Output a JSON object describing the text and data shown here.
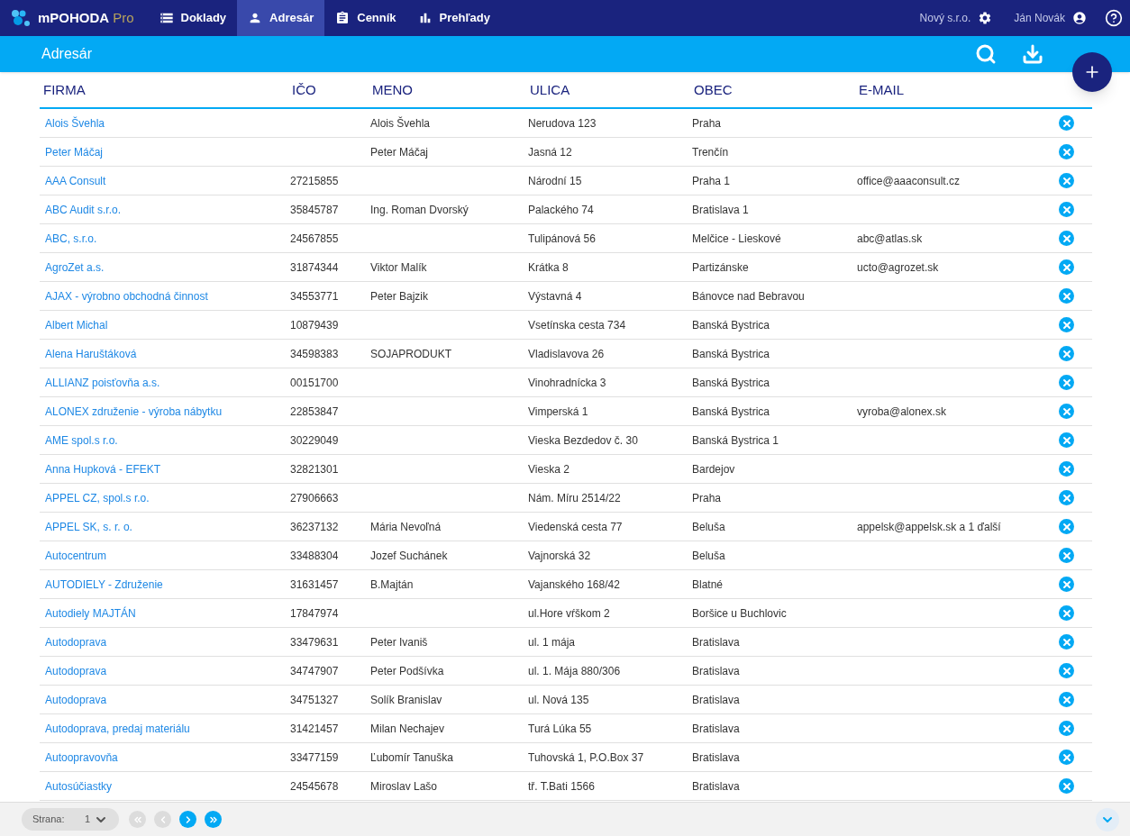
{
  "app": {
    "name": "mPOHODA",
    "edition": "Pro"
  },
  "nav": [
    {
      "label": "Doklady",
      "kind": "documents",
      "selected": false
    },
    {
      "label": "Adresár",
      "kind": "contacts",
      "selected": true
    },
    {
      "label": "Cenník",
      "kind": "pricelist",
      "selected": false
    },
    {
      "label": "Prehľady",
      "kind": "reports",
      "selected": false
    }
  ],
  "company": "Nový s.r.o.",
  "user": "Ján Novák",
  "page_title": "Adresár",
  "table": {
    "columns": [
      "FIRMA",
      "IČO",
      "MENO",
      "ULICA",
      "OBEC",
      "E-MAIL"
    ],
    "rows": [
      [
        "Alois Švehla",
        "",
        "Alois Švehla",
        "Nerudova 123",
        "Praha",
        ""
      ],
      [
        "Peter Máčaj",
        "",
        "Peter Máčaj",
        "Jasná 12",
        "Trenčín",
        ""
      ],
      [
        "AAA Consult",
        "27215855",
        "",
        "Národní 15",
        "Praha 1",
        "office@aaaconsult.cz"
      ],
      [
        "ABC Audit s.r.o.",
        "35845787",
        "Ing. Roman Dvorský",
        "Palackého 74",
        "Bratislava 1",
        ""
      ],
      [
        "ABC, s.r.o.",
        "24567855",
        "",
        "Tulipánová 56",
        "Melčice - Lieskové",
        "abc@atlas.sk"
      ],
      [
        "AgroZet a.s.",
        "31874344",
        "Viktor Malík",
        "Krátka 8",
        "Partizánske",
        "ucto@agrozet.sk"
      ],
      [
        "AJAX - výrobno obchodná činnost",
        "34553771",
        "Peter Bajzik",
        "Výstavná 4",
        "Bánovce nad Bebravou",
        ""
      ],
      [
        "Albert Michal",
        "10879439",
        "",
        "Vsetínska cesta 734",
        "Banská Bystrica",
        ""
      ],
      [
        "Alena Haruštáková",
        "34598383",
        "SOJAPRODUKT",
        "Vladislavova 26",
        "Banská Bystrica",
        ""
      ],
      [
        "ALLIANZ poisťovňa a.s.",
        "00151700",
        "",
        "Vinohradnícka 3",
        "Banská Bystrica",
        ""
      ],
      [
        "ALONEX združenie - výroba nábytku",
        "22853847",
        "",
        "Vimperská 1",
        "Banská Bystrica",
        "vyroba@alonex.sk"
      ],
      [
        "AME spol.s r.o.",
        "30229049",
        "",
        "Vieska Bezdedov č. 30",
        "Banská Bystrica 1",
        ""
      ],
      [
        "Anna Hupková - EFEKT",
        "32821301",
        "",
        "Vieska 2",
        "Bardejov",
        ""
      ],
      [
        "APPEL CZ, spol.s r.o.",
        "27906663",
        "",
        "Nám. Míru 2514/22",
        "Praha",
        ""
      ],
      [
        "APPEL SK, s. r. o.",
        "36237132",
        "Mária Nevoľná",
        "Viedenská cesta 77",
        "Beluša",
        "appelsk@appelsk.sk a 1 ďalší"
      ],
      [
        "Autocentrum",
        "33488304",
        "Jozef Suchánek",
        "Vajnorská 32",
        "Beluša",
        ""
      ],
      [
        "AUTODIELY - Združenie",
        "31631457",
        "B.Majtán",
        "Vajanského 168/42",
        "Blatné",
        ""
      ],
      [
        "Autodiely MAJTÁN",
        "17847974",
        "",
        "ul.Hore vŕškom 2",
        "Boršice u Buchlovic",
        ""
      ],
      [
        "Autodoprava",
        "33479631",
        "Peter Ivaniš",
        "ul. 1 mája",
        "Bratislava",
        ""
      ],
      [
        "Autodoprava",
        "34747907",
        "Peter Podšívka",
        "ul. 1. Mája 880/306",
        "Bratislava",
        ""
      ],
      [
        "Autodoprava",
        "34751327",
        "Solík Branislav",
        "ul. Nová 135",
        "Bratislava",
        ""
      ],
      [
        "Autodoprava, predaj materiálu",
        "31421457",
        "Milan Nechajev",
        "Turá Lúka 55",
        "Bratislava",
        ""
      ],
      [
        "Autoopravovňa",
        "33477159",
        "Ľubomír Tanuška",
        "Tuhovská 1, P.O.Box 37",
        "Bratislava",
        ""
      ],
      [
        "Autosúčiastky",
        "24545678",
        "Miroslav Lašo",
        "tř. T.Bati 1566",
        "Bratislava",
        ""
      ]
    ]
  },
  "pager": {
    "label": "Strana:",
    "page": "1",
    "buttons": [
      {
        "kind": "first",
        "disabled": true
      },
      {
        "kind": "prev",
        "disabled": true
      },
      {
        "kind": "next",
        "disabled": false
      },
      {
        "kind": "last",
        "disabled": false
      }
    ]
  }
}
